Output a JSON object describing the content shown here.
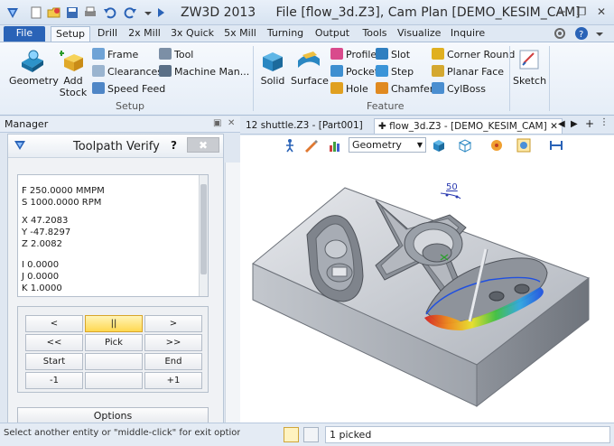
{
  "titlebar": {
    "app": "ZW3D 2013",
    "file_info": "File [flow_3d.Z3],  Cam Plan [DEMO_KESIM_CAM]"
  },
  "tabs": [
    "File",
    "Setup",
    "Drill",
    "2x Mill",
    "3x Quick",
    "5x Mill",
    "Turning",
    "Output",
    "Tools",
    "Visualize",
    "Inquire"
  ],
  "active_tab": "Setup",
  "ribbon": {
    "setup": {
      "geometry": "Geometry",
      "add_stock_1": "Add",
      "add_stock_2": "Stock",
      "frame": "Frame",
      "clearances": "Clearances",
      "speed_feed": "Speed Feed",
      "tool": "Tool",
      "machine_man": "Machine Man...",
      "label": "Setup"
    },
    "feature": {
      "solid": "Solid",
      "surface": "Surface",
      "profile": "Profile",
      "pocket": "Pocket",
      "hole": "Hole",
      "slot": "Slot",
      "step": "Step",
      "chamfer": "Chamfer",
      "corner_round": "Corner Round",
      "planar_face": "Planar Face",
      "cylboss": "CylBoss",
      "label": "Feature"
    },
    "sketch": "Sketch"
  },
  "manager": {
    "title": "Manager"
  },
  "verify": {
    "title": "Toolpath Verify",
    "help": "?",
    "close": "✖",
    "lines": [
      "F  250.0000 MMPM",
      "S 1000.0000 RPM",
      "X   47.2083",
      "Y  -47.8297",
      "Z    2.0082",
      "I    0.0000",
      "J    0.0000",
      "K    1.0000"
    ],
    "buttons": {
      "prev": "<",
      "pause": "||",
      "next": ">",
      "rewind": "<<",
      "pick": "Pick",
      "forward": ">>",
      "start": "Start",
      "end": "End",
      "minus1": "-1",
      "plus1": "+1"
    },
    "options": "Options"
  },
  "doctabs": {
    "tab1": "12 shuttle.Z3 - [Part001]",
    "tab2": "flow_3d.Z3 - [DEMO_KESIM_CAM]"
  },
  "viewport": {
    "filter": "Geometry",
    "dimension": "50"
  },
  "status": {
    "message": "Select another entity or \"middle-click\" for exit options.",
    "picked": "1 picked"
  },
  "colors": {
    "accent": "#2a63b7",
    "toolpath_low": "#d42020",
    "toolpath_high": "#2050e0"
  }
}
